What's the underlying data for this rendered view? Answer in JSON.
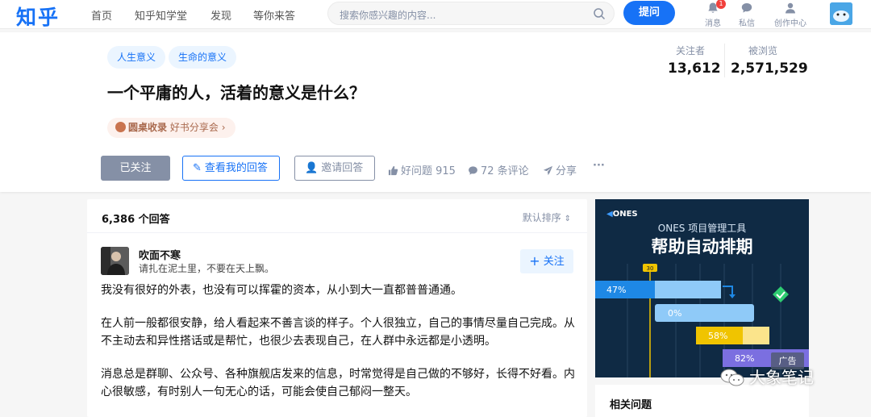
{
  "nav": {
    "logo": "知乎",
    "links": [
      "首页",
      "知乎知学堂",
      "发现",
      "等你来答"
    ],
    "search_placeholder": "搜索你感兴趣的内容...",
    "ask_label": "提问",
    "icons": [
      {
        "label": "消息",
        "icon": "bell-icon",
        "badge": "1"
      },
      {
        "label": "私信",
        "icon": "chat-icon"
      },
      {
        "label": "创作中心",
        "icon": "creator-icon"
      }
    ]
  },
  "question": {
    "tags": [
      "人生意义",
      "生命的意义"
    ],
    "title": "一个平庸的人，活着的意义是什么？",
    "roundtable_label": "圆桌收录",
    "roundtable_name": "好书分享会",
    "stats": {
      "followers_label": "关注者",
      "followers_value": "13,612",
      "views_label": "被浏览",
      "views_value": "2,571,529"
    },
    "actions": {
      "followed": "已关注",
      "my_answer": "查看我的回答",
      "invite": "邀请回答",
      "good_question": "好问题 915",
      "comments": "72 条评论",
      "share": "分享",
      "more": "···"
    }
  },
  "answers": {
    "count": "6,386 个回答",
    "sort": "默认排序",
    "first": {
      "author": "吹面不寒",
      "bio": "请扎在泥土里，不要在天上飘。",
      "follow": "关注",
      "paragraphs": [
        "我没有很好的外表，也没有可以挥霍的资本，从小到大一直都普普通通。",
        "在人前一般都很安静，给人看起来不善言谈的样子。个人很独立，自己的事情尽量自己完成。从不主动去和异性搭话或是帮忙，也很少去表现自己，在人群中永远都是小透明。",
        "消息总是群聊、公众号、各种旗舰店发来的信息，时常觉得是自己做的不够好，长得不好看。内心很敏感，有时别人一句无心的话，可能会使自己郁闷一整天。"
      ]
    }
  },
  "ad": {
    "brand": "ONES",
    "subtitle": "ONES 项目管理工具",
    "title": "帮助自动排期",
    "badge": "广告",
    "timeline_marker": "30",
    "bars": [
      {
        "label": "47%",
        "progress": 0.47
      },
      {
        "label": "0%",
        "progress": 0.0
      },
      {
        "label": "58%",
        "progress": 0.58
      },
      {
        "label": "82%",
        "progress": 0.82
      }
    ]
  },
  "related": {
    "title": "相关问题"
  },
  "watermark": "大象笔记",
  "colors": {
    "brand": "#1772f6",
    "ad_bg": "#0f2a44"
  }
}
